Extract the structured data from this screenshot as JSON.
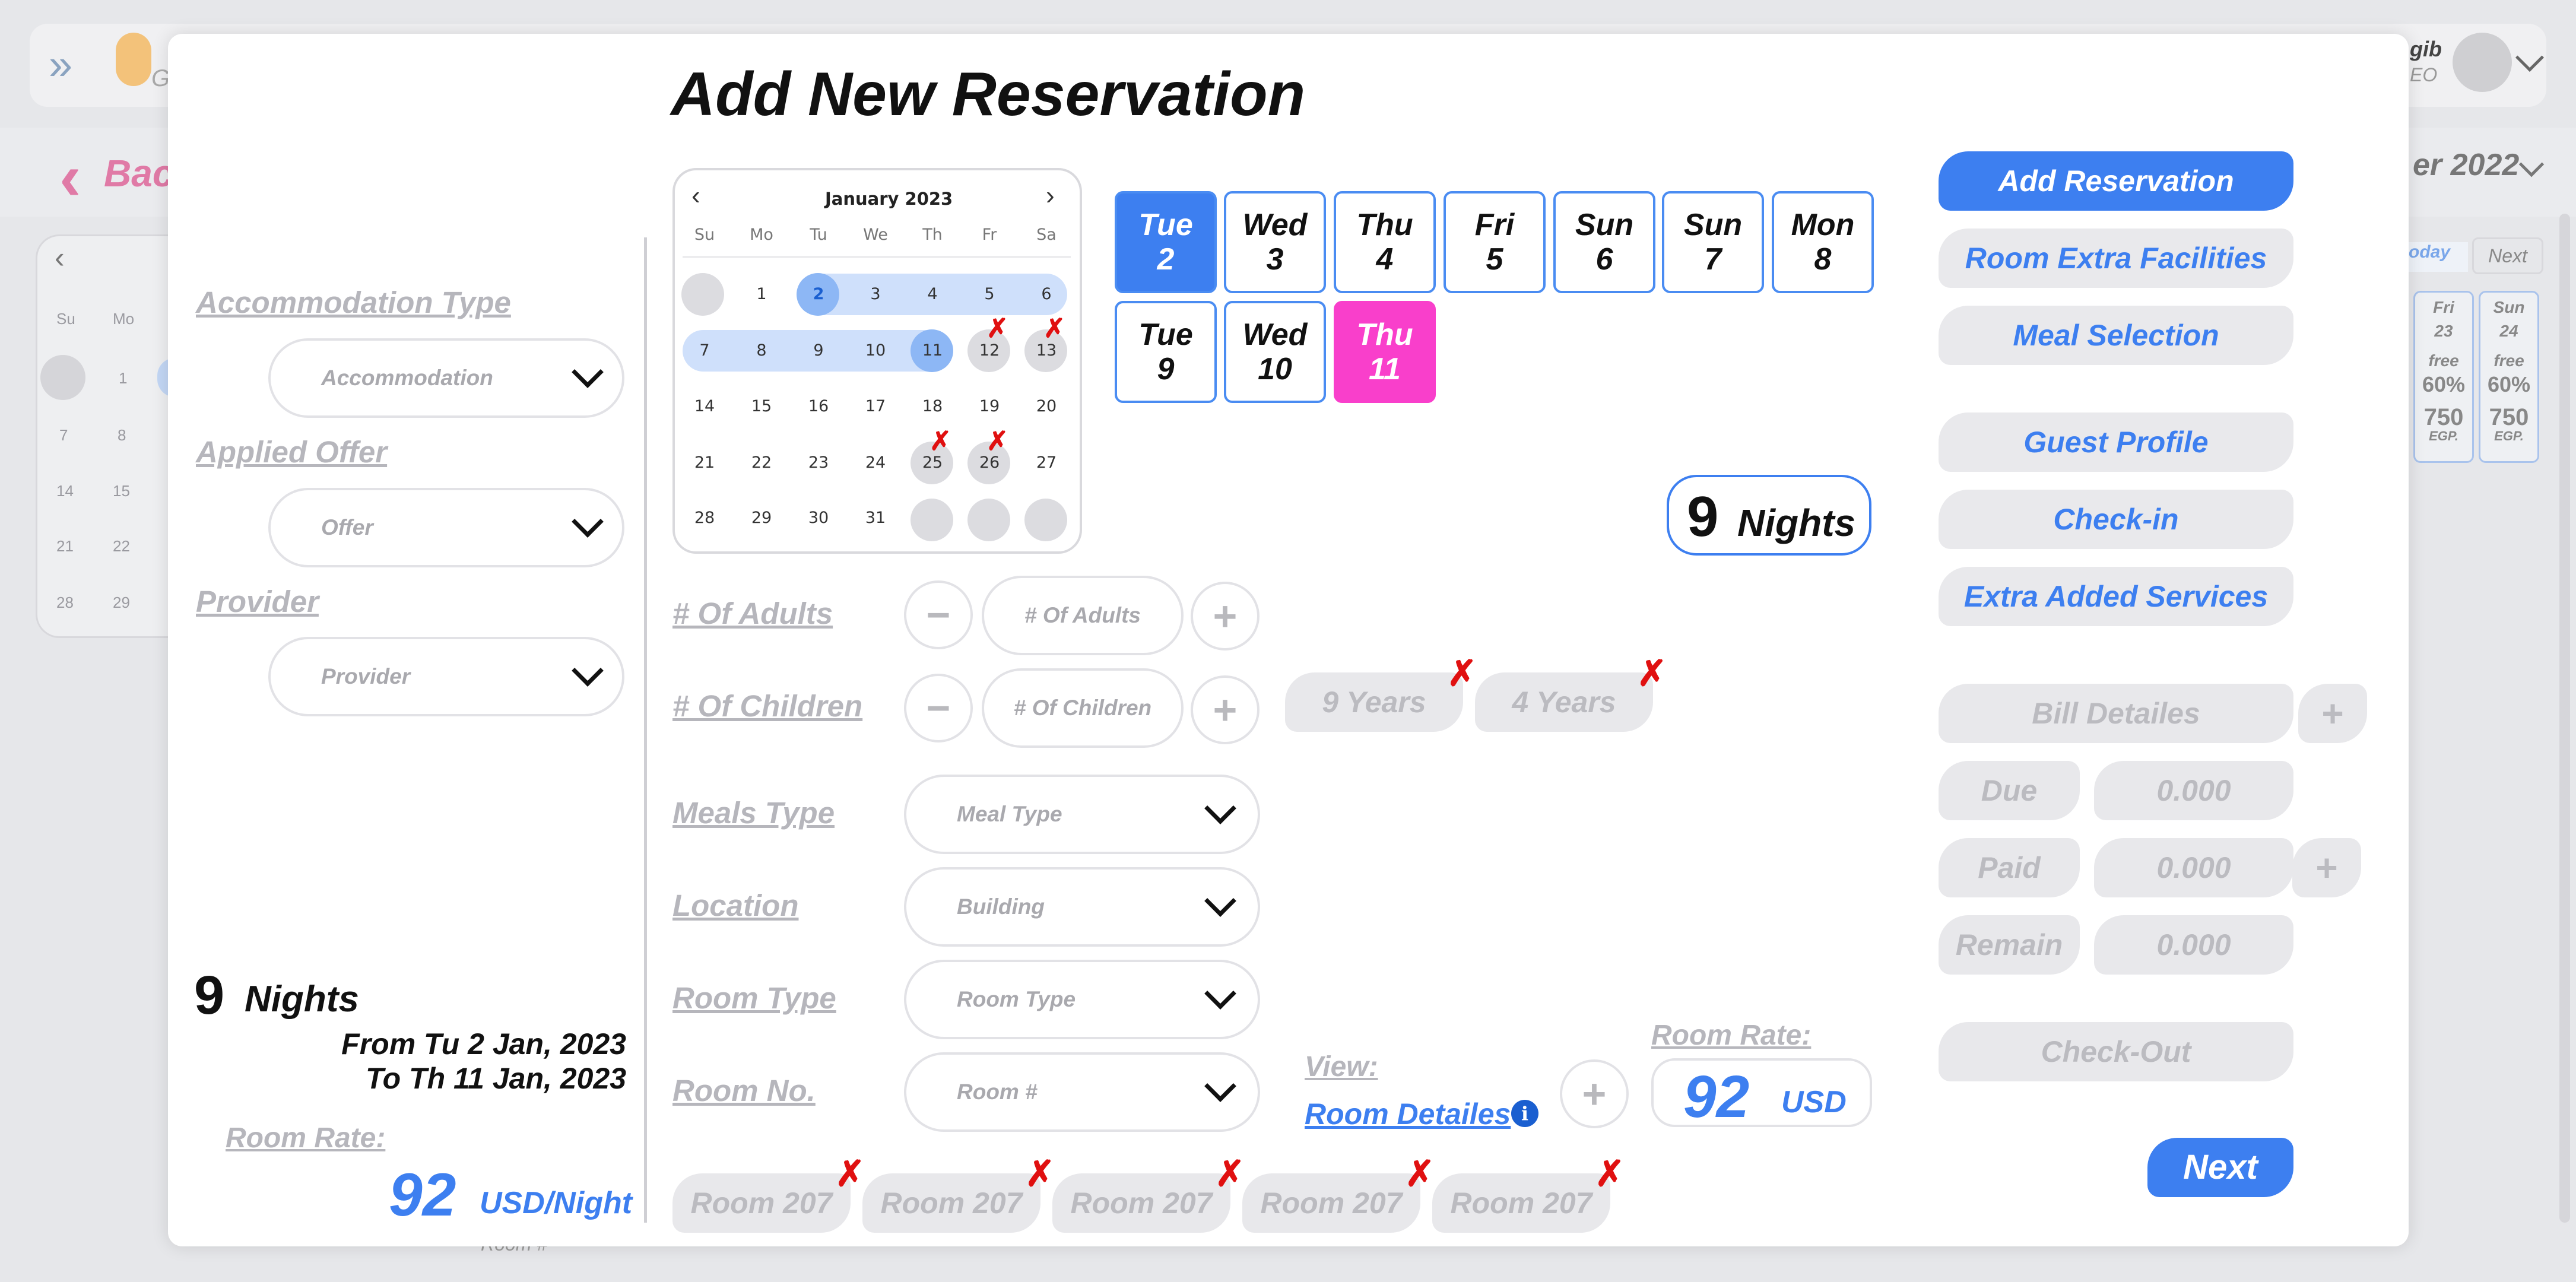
{
  "background": {
    "user_name": "gib",
    "user_role": "EO",
    "back_label": "Bac",
    "month_label": "er 2022",
    "logo_text": "G",
    "today_label": "oday",
    "next_label": "Next",
    "cal_headers": [
      "Su",
      "Mo"
    ],
    "cal_rows": [
      [
        "",
        "1"
      ],
      [
        "7",
        "8"
      ],
      [
        "14",
        "15"
      ],
      [
        "21",
        "22"
      ],
      [
        "28",
        "29"
      ]
    ],
    "right_cards": [
      {
        "d1": "Fri",
        "d2": "23",
        "free": "free",
        "pct": "60%",
        "price": "750",
        "cur": "EGP."
      },
      {
        "d1": "Sun",
        "d2": "24",
        "free": "free",
        "pct": "60%",
        "price": "750",
        "cur": "EGP."
      }
    ],
    "room_label": "Room #"
  },
  "title": "Add New Reservation",
  "left": {
    "accommodation_label": "Accommodation Type",
    "accommodation_value": "Accommodation",
    "offer_label": "Applied Offer",
    "offer_value": "Offer",
    "provider_label": "Provider",
    "provider_value": "Provider",
    "nights_num": "9",
    "nights_word": "Nights",
    "from": "From Tu 2 Jan, 2023",
    "to": "To Th 11 Jan, 2023",
    "rate_label": "Room Rate:",
    "rate_value": "92",
    "rate_unit": "USD/Night"
  },
  "calendar": {
    "month": "January 2023",
    "headers": [
      "Su",
      "Mo",
      "Tu",
      "We",
      "Th",
      "Fr",
      "Sa"
    ],
    "rows": [
      [
        "",
        "1",
        "2",
        "3",
        "4",
        "5",
        "6"
      ],
      [
        "7",
        "8",
        "9",
        "10",
        "11",
        "12",
        "13"
      ],
      [
        "14",
        "15",
        "16",
        "17",
        "18",
        "19",
        "20"
      ],
      [
        "21",
        "22",
        "23",
        "24",
        "25",
        "26",
        "27"
      ],
      [
        "28",
        "29",
        "30",
        "31",
        "",
        "",
        ""
      ]
    ]
  },
  "days": [
    {
      "d": "Tue",
      "n": "2"
    },
    {
      "d": "Wed",
      "n": "3"
    },
    {
      "d": "Thu",
      "n": "4"
    },
    {
      "d": "Fri",
      "n": "5"
    },
    {
      "d": "Sun",
      "n": "6"
    },
    {
      "d": "Sun",
      "n": "7"
    },
    {
      "d": "Mon",
      "n": "8"
    },
    {
      "d": "Tue",
      "n": "9"
    },
    {
      "d": "Wed",
      "n": "10"
    },
    {
      "d": "Thu",
      "n": "11"
    }
  ],
  "nights_box": {
    "num": "9",
    "word": "Nights"
  },
  "form": {
    "adults_label": "# Of Adults",
    "adults_placeholder": "# Of Adults",
    "children_label": "# Of Children",
    "children_placeholder": "# Of Children",
    "child_ages": [
      "9 Years",
      "4 Years"
    ],
    "meals_label": "Meals Type",
    "meals_value": "Meal Type",
    "location_label": "Location",
    "location_value": "Building",
    "roomtype_label": "Room Type",
    "roomtype_value": "Room Type",
    "roomno_label": "Room No.",
    "roomno_value": "Room #",
    "view_label": "View:",
    "room_details": "Room Detailes",
    "rate_label": "Room Rate:",
    "rate_value": "92",
    "rate_unit": "USD",
    "rooms": [
      "Room 207",
      "Room 207",
      "Room 207",
      "Room 207",
      "Room 207"
    ]
  },
  "right": {
    "add_reservation": "Add Reservation",
    "extra_facilities": "Room Extra Facilities",
    "meal_selection": "Meal Selection",
    "guest_profile": "Guest Profile",
    "checkin": "Check-in",
    "extra_services": "Extra Added Services",
    "bill_details": "Bill Detailes",
    "due": "Due",
    "due_value": "0.000",
    "paid": "Paid",
    "paid_value": "0.000",
    "remain": "Remain",
    "remain_value": "0.000",
    "checkout": "Check-Out",
    "next": "Next"
  },
  "colors": {
    "accent": "#3d7ff0",
    "pink": "#f93fcb",
    "error": "#e01010"
  }
}
